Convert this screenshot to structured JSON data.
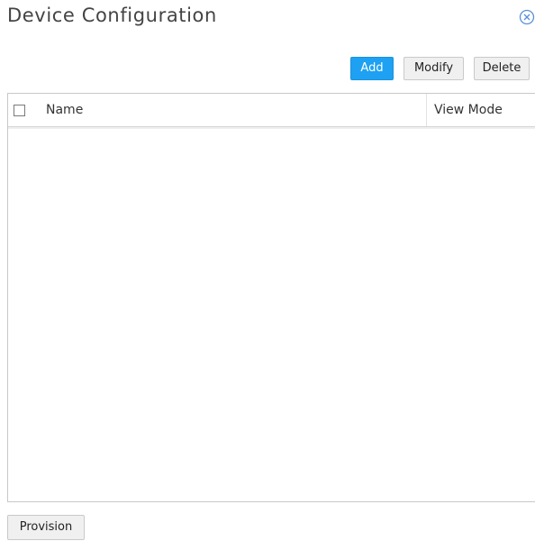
{
  "dialog": {
    "title": "Device Configuration",
    "close_icon": "close-circle-icon"
  },
  "toolbar": {
    "add_label": "Add",
    "modify_label": "Modify",
    "delete_label": "Delete"
  },
  "grid": {
    "columns": [
      {
        "label": "Name"
      },
      {
        "label": "View Mode"
      }
    ],
    "rows": []
  },
  "footer": {
    "provision_label": "Provision"
  },
  "colors": {
    "accent": "#1ea1f2",
    "close_icon": "#5b8fd6"
  }
}
